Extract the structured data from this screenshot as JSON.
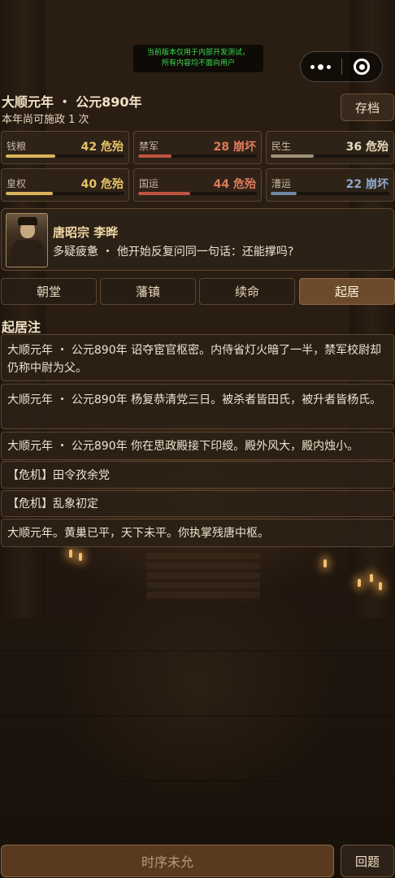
{
  "dev_notice": {
    "line1": "当前版本仅用于内部开发测试，",
    "line2": "所有内容均不面向用户"
  },
  "header": {
    "year_line": "大顺元年 ・ 公元890年",
    "actions_left": "本年尚可施政 1 次",
    "save_label": "存档"
  },
  "stats": [
    {
      "label": "钱粮",
      "value": "42 危殆",
      "level": 0.42,
      "color": "#e8c468",
      "bar_color": "#d9b45a"
    },
    {
      "label": "禁军",
      "value": "28 崩坏",
      "level": 0.28,
      "color": "#e07a5a",
      "bar_color": "#c0533f"
    },
    {
      "label": "民生",
      "value": "36 危殆",
      "level": 0.36,
      "color": "#e8d9bf",
      "bar_color": "#a09078"
    },
    {
      "label": "皇权",
      "value": "40 危殆",
      "level": 0.4,
      "color": "#e8c468",
      "bar_color": "#d9b45a"
    },
    {
      "label": "国运",
      "value": "44 危殆",
      "level": 0.44,
      "color": "#e07a5a",
      "bar_color": "#c0533f"
    },
    {
      "label": "漕运",
      "value": "22 崩坏",
      "level": 0.22,
      "color": "#8fa8c8",
      "bar_color": "#6f87a6"
    }
  ],
  "emperor": {
    "name": "唐昭宗  李晔",
    "status": "多疑疲惫 ・ 他开始反复问同一句话：还能撑吗?"
  },
  "tabs": [
    "朝堂",
    "藩镇",
    "续命",
    "起居"
  ],
  "active_tab": "起居",
  "log": {
    "title": "起居注",
    "items": [
      "大顺元年 ・ 公元890年  诏夺宦官枢密。内侍省灯火暗了一半，禁军校尉却仍称中尉为父。",
      "大顺元年 ・ 公元890年  杨复恭清党三日。被杀者皆田氏，被升者皆杨氏。",
      "大顺元年 ・ 公元890年  你在思政殿接下印绶。殿外风大，殿内烛小。",
      "【危机】田令孜余党",
      "【危机】乱象初定",
      "大顺元年。黄巢已平，天下未平。你执掌残唐中枢。"
    ]
  },
  "bottom": {
    "main_label": "时序未允",
    "side_label": "回题"
  }
}
